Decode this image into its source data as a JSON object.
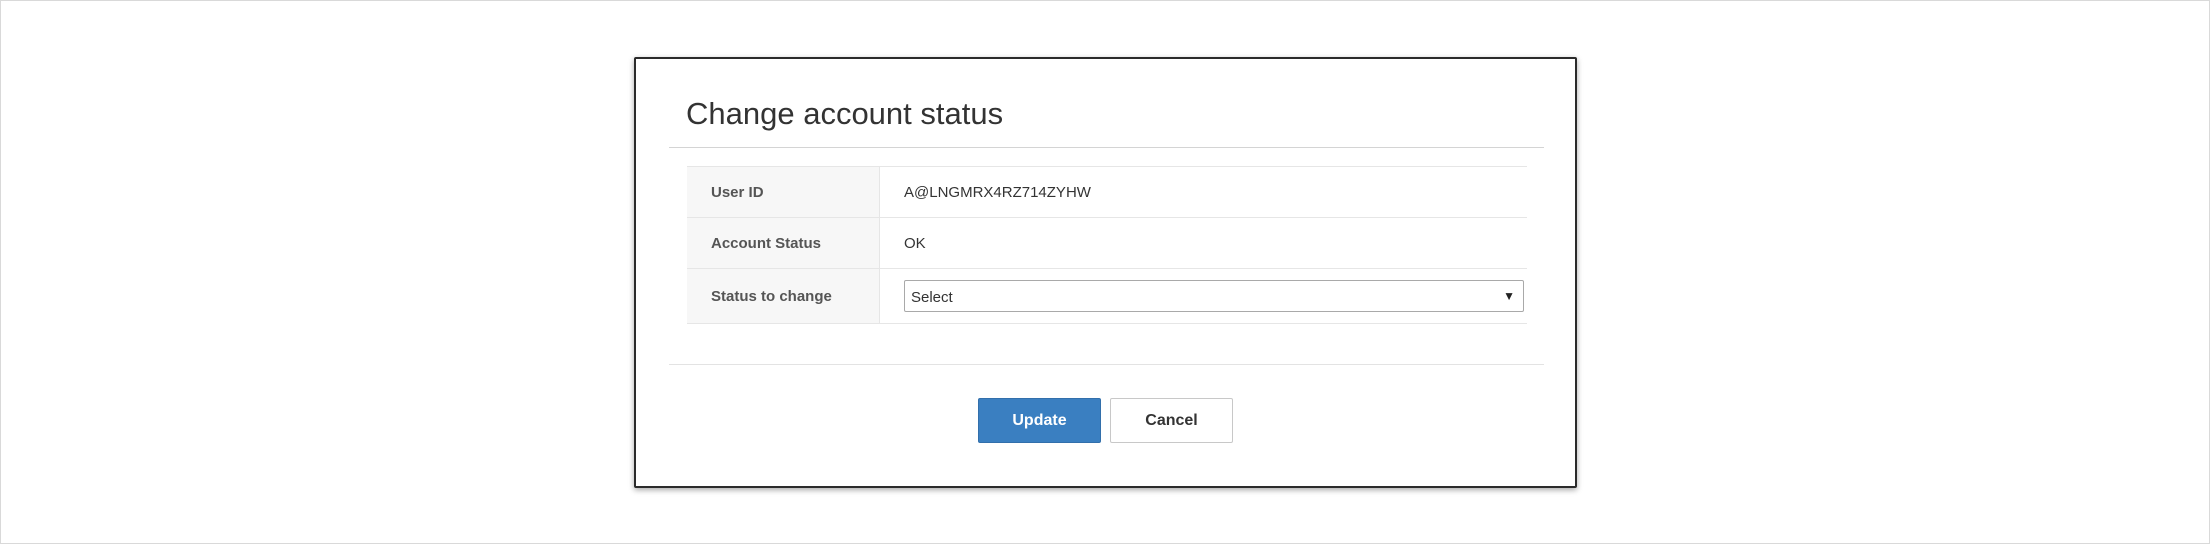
{
  "dialog": {
    "title": "Change account status"
  },
  "details": {
    "user_id_label": "User ID",
    "user_id_value": "A@LNGMRX4RZ714ZYHW",
    "account_status_label": "Account Status",
    "account_status_value": "OK",
    "status_to_change_label": "Status to change"
  },
  "status_select": {
    "selected": "Select",
    "arrow_icon": "triangle-down-icon"
  },
  "buttons": {
    "update_label": "Update",
    "cancel_label": "Cancel"
  },
  "colors": {
    "primary": "#3a7fc1",
    "label_background": "#f7f7f7",
    "modal_border": "#2b2b2b"
  }
}
